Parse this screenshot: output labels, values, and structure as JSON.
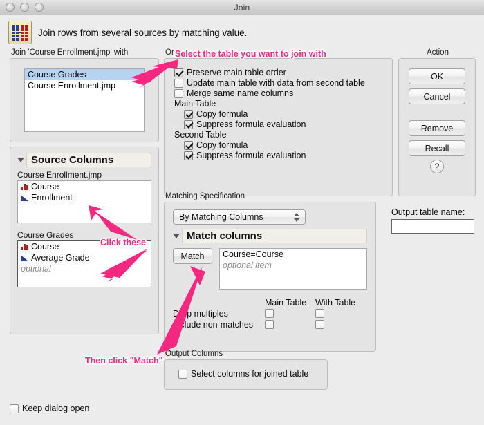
{
  "window": {
    "title": "Join",
    "controls": [
      "close-button",
      "minimize-button",
      "zoom-button"
    ]
  },
  "banner": {
    "icon": "join-tables-icon",
    "text": "Join rows from several sources by matching value."
  },
  "join_with": {
    "label": "Join 'Course Enrollment.jmp' with",
    "items": [
      {
        "label": "Course Grades",
        "selected": true
      },
      {
        "label": "Course Enrollment.jmp",
        "selected": false
      }
    ]
  },
  "source_columns": {
    "title": "Source Columns",
    "groups": [
      {
        "table": "Course Enrollment.jmp",
        "columns": [
          {
            "name": "Course",
            "icon": "nominal-bars-icon"
          },
          {
            "name": "Enrollment",
            "icon": "continuous-triangle-icon"
          }
        ],
        "placeholder": ""
      },
      {
        "table": "Course Grades",
        "columns": [
          {
            "name": "Course",
            "icon": "nominal-bars-icon"
          },
          {
            "name": "Average Grade",
            "icon": "continuous-triangle-icon"
          }
        ],
        "placeholder": "optional"
      }
    ]
  },
  "options": {
    "or_label": "Or",
    "checkboxes": [
      {
        "label": "Preserve main table order",
        "checked": true
      },
      {
        "label": "Update main table with data from second table",
        "checked": false
      },
      {
        "label": "Merge same name columns",
        "checked": false
      }
    ],
    "main_table_label": "Main Table",
    "main_table_options": [
      {
        "label": "Copy formula",
        "checked": true
      },
      {
        "label": "Suppress formula evaluation",
        "checked": true
      }
    ],
    "second_table_label": "Second Table",
    "second_table_options": [
      {
        "label": "Copy formula",
        "checked": true
      },
      {
        "label": "Suppress formula evaluation",
        "checked": true
      }
    ]
  },
  "matching": {
    "label": "Matching Specification",
    "method": "By Matching Columns",
    "match_columns_title": "Match columns",
    "match_button": "Match",
    "matches": [
      "Course=Course"
    ],
    "matches_placeholder": "optional item",
    "col_main": "Main Table",
    "col_with": "With Table",
    "rows": [
      {
        "label": "Drop multiples",
        "main_checked": false,
        "with_checked": false
      },
      {
        "label": "Include non-matches",
        "main_checked": false,
        "with_checked": false
      }
    ]
  },
  "output_columns": {
    "label": "Output Columns",
    "checkbox": {
      "label": "Select columns for joined table",
      "checked": false
    }
  },
  "action": {
    "label": "Action",
    "buttons": [
      "OK",
      "Cancel",
      "Remove",
      "Recall"
    ],
    "help": "?"
  },
  "output_table": {
    "label": "Output table name:",
    "value": "",
    "placeholder": ""
  },
  "footer": {
    "keep_open": {
      "label": "Keep dialog open",
      "checked": false
    }
  },
  "annotations": [
    {
      "text": "Select the table you want to join with"
    },
    {
      "text": "Click these"
    },
    {
      "text": "Then click \"Match\""
    }
  ],
  "colors": {
    "annotation": "#f5287f",
    "selection": "#b6d4f2",
    "nominal_icon": "#b12222",
    "continuous_icon": "#2d3f8f"
  }
}
